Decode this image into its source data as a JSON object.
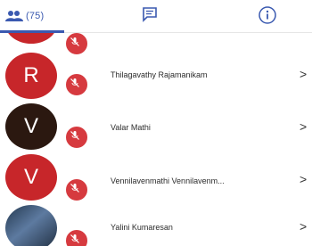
{
  "tabs": {
    "participants_count": "(75)",
    "accent": "#3a59b0"
  },
  "contacts": [
    {
      "initial": "R",
      "name": "Thilagavathy Rajamanikam",
      "avatar": "red"
    },
    {
      "initial": "V",
      "name": "Valar Mathi",
      "avatar": "dark"
    },
    {
      "initial": "V",
      "name": "Vennilavenmathi Vennilavenm...",
      "avatar": "red"
    },
    {
      "initial": "",
      "name": "Yalini Kumaresan",
      "avatar": "photo"
    }
  ],
  "chevron": ">",
  "colors": {
    "avatar_red": "#c7262a",
    "avatar_dark": "#2b1810",
    "badge": "#d63a3f"
  }
}
